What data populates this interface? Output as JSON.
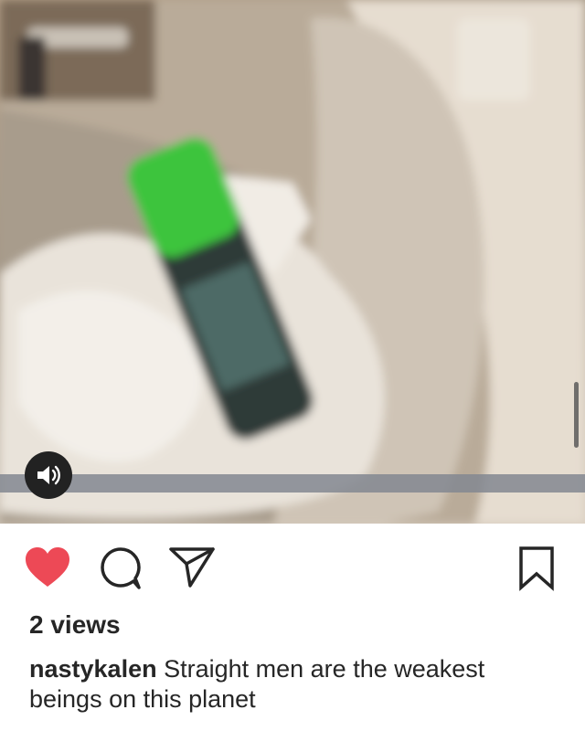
{
  "video": {
    "progress_fraction": 1.0,
    "sound_icon": "speaker-sound-icon"
  },
  "actions": {
    "like_icon": "heart-filled-icon",
    "like_color": "#ed4956",
    "comment_icon": "comment-bubble-icon",
    "share_icon": "paper-plane-icon",
    "save_icon": "bookmark-icon"
  },
  "post": {
    "views": "2 views",
    "username": "nastykalen",
    "caption": "Straight men are the weakest beings on this planet"
  }
}
